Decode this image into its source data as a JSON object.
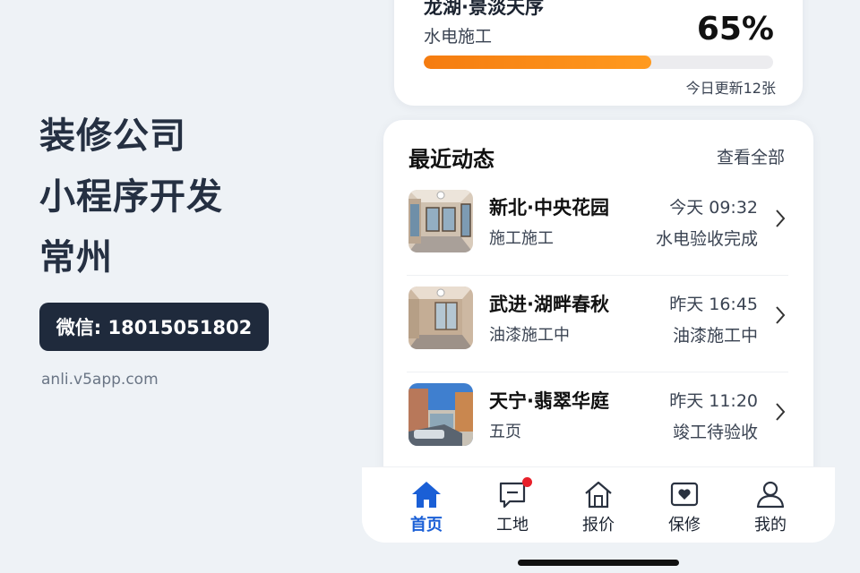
{
  "promo": {
    "lines": [
      "装修公司",
      "小程序开发",
      "常州"
    ],
    "wechat": "微信: 18015051802",
    "site": "anli.v5app.com"
  },
  "progress_card": {
    "project": "龙湖·景淡天序",
    "stage": "水电施工",
    "percent_label": "65%",
    "percent": 65,
    "updated": "今日更新12张",
    "bar_color": "#f57c10"
  },
  "feed": {
    "title": "最近动态",
    "more": "查看全部",
    "items": [
      {
        "name": "新北·中央花园",
        "sub": "施工施工",
        "time": "今天 09:32",
        "status": "水电验收完成"
      },
      {
        "name": "武进·湖畔春秋",
        "sub": "油漆施工中",
        "time": "昨天 16:45",
        "status": "油漆施工中"
      },
      {
        "name": "天宁·翡翠华庭",
        "sub": "五页",
        "time": "昨天 11:20",
        "status": "竣工待验收"
      }
    ]
  },
  "tabbar": {
    "active_color": "#1a5fd6",
    "items": [
      {
        "label": "首页",
        "icon": "home-icon",
        "active": true
      },
      {
        "label": "工地",
        "icon": "site-message-icon",
        "badge": true
      },
      {
        "label": "报价",
        "icon": "quote-house-icon"
      },
      {
        "label": "保修",
        "icon": "warranty-heart-icon"
      },
      {
        "label": "我的",
        "icon": "profile-icon"
      }
    ]
  }
}
